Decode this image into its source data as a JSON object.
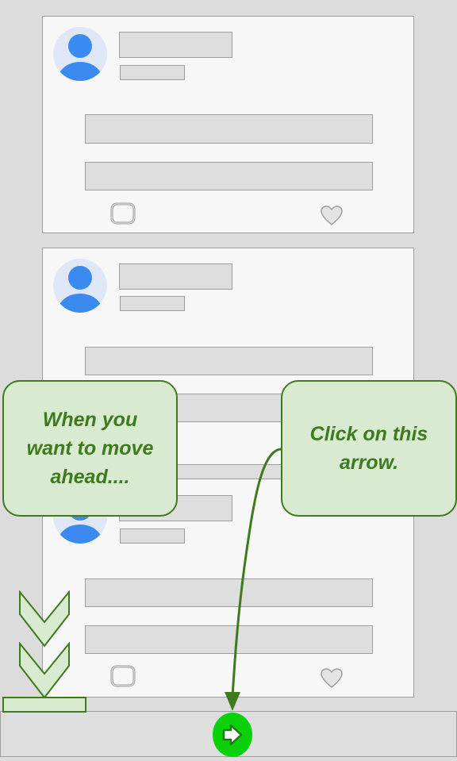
{
  "feed": {
    "posts": [
      {
        "has_repost_icon": true,
        "has_like_icon": true
      },
      {
        "has_repost_icon": true,
        "has_like_icon": true
      },
      {
        "has_repost_icon": true,
        "has_like_icon": true
      }
    ]
  },
  "callouts": {
    "left_text": "When you want to move ahead....",
    "right_text": "Click on this arrow."
  },
  "colors": {
    "callout_fill": "#d8ead0",
    "callout_border": "#3e7a1e",
    "next_button": "#0ad10a",
    "avatar": "#3b8af0"
  },
  "icons": {
    "avatar": "user-avatar-icon",
    "repost": "repost-icon",
    "like": "heart-icon",
    "next": "arrow-right-icon",
    "scroll_hint": "chevron-down-icon"
  }
}
